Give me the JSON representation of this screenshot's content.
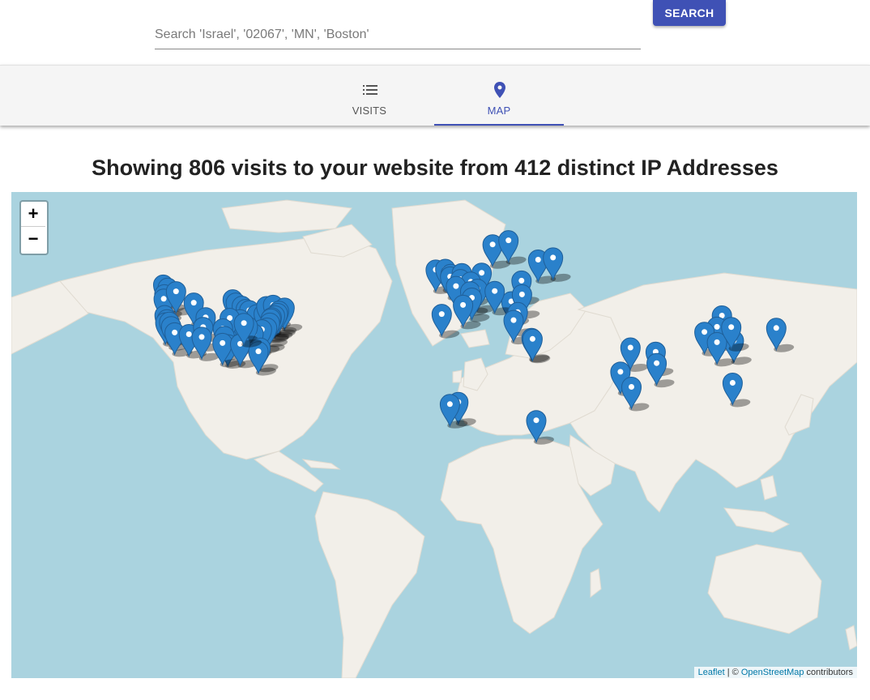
{
  "search": {
    "placeholder": "Search 'Israel', '02067', 'MN', 'Boston'",
    "value": "",
    "button_label": "SEARCH"
  },
  "tabs": [
    {
      "label": "VISITS",
      "icon": "list-icon",
      "active": false
    },
    {
      "label": "MAP",
      "icon": "location-pin-icon",
      "active": true
    }
  ],
  "heading": "Showing 806 visits to your website from 412 distinct IP Addresses",
  "map": {
    "zoom_in_label": "+",
    "zoom_out_label": "−",
    "attribution": {
      "leaflet_link": "Leaflet",
      "separator": " | © ",
      "osm_link": "OpenStreetMap",
      "suffix": " contributors"
    },
    "colors": {
      "water": "#aad3df",
      "land": "#f2efe9",
      "marker": "#2a81cb",
      "accent": "#3f51b5"
    },
    "markers": [
      {
        "lat": 49.3,
        "lon": -123.1
      },
      {
        "lat": 48.4,
        "lon": -121.2
      },
      {
        "lat": 46.5,
        "lon": -122.6
      },
      {
        "lat": 45.2,
        "lon": -122.9
      },
      {
        "lat": 47.4,
        "lon": -117.6
      },
      {
        "lat": 44.0,
        "lon": -110.0
      },
      {
        "lat": 40.0,
        "lon": -122.5
      },
      {
        "lat": 38.6,
        "lon": -121.5
      },
      {
        "lat": 37.6,
        "lon": -122.2
      },
      {
        "lat": 37.8,
        "lon": -120.5
      },
      {
        "lat": 36.3,
        "lon": -119.7
      },
      {
        "lat": 34.1,
        "lon": -118.2
      },
      {
        "lat": 33.5,
        "lon": -112.1
      },
      {
        "lat": 39.3,
        "lon": -104.9
      },
      {
        "lat": 36.0,
        "lon": -106.0
      },
      {
        "lat": 32.5,
        "lon": -106.6
      },
      {
        "lat": 45.0,
        "lon": -93.3
      },
      {
        "lat": 44.0,
        "lon": -92.0
      },
      {
        "lat": 43.0,
        "lon": -89.4
      },
      {
        "lat": 42.0,
        "lon": -87.7
      },
      {
        "lat": 41.6,
        "lon": -86.2
      },
      {
        "lat": 40.3,
        "lon": -83.0
      },
      {
        "lat": 40.5,
        "lon": -80.0
      },
      {
        "lat": 42.9,
        "lon": -78.9
      },
      {
        "lat": 43.3,
        "lon": -76.0
      },
      {
        "lat": 42.4,
        "lon": -71.1
      },
      {
        "lat": 41.4,
        "lon": -73.5
      },
      {
        "lat": 40.7,
        "lon": -74.0
      },
      {
        "lat": 39.9,
        "lon": -75.2
      },
      {
        "lat": 39.3,
        "lon": -76.6
      },
      {
        "lat": 38.9,
        "lon": -77.0
      },
      {
        "lat": 37.5,
        "lon": -77.4
      },
      {
        "lat": 35.8,
        "lon": -78.6
      },
      {
        "lat": 35.2,
        "lon": -80.8
      },
      {
        "lat": 33.7,
        "lon": -84.4
      },
      {
        "lat": 36.2,
        "lon": -86.8
      },
      {
        "lat": 35.1,
        "lon": -90.0
      },
      {
        "lat": 38.6,
        "lon": -90.2
      },
      {
        "lat": 39.1,
        "lon": -94.6
      },
      {
        "lat": 35.5,
        "lon": -97.5
      },
      {
        "lat": 32.8,
        "lon": -96.8
      },
      {
        "lat": 29.8,
        "lon": -95.4
      },
      {
        "lat": 30.3,
        "lon": -97.7
      },
      {
        "lat": 30.0,
        "lon": -90.1
      },
      {
        "lat": 28.5,
        "lon": -81.4
      },
      {
        "lat": 27.2,
        "lon": -82.3
      },
      {
        "lat": 37.4,
        "lon": -88.5
      },
      {
        "lat": 53.3,
        "lon": -6.3
      },
      {
        "lat": 53.5,
        "lon": -2.2
      },
      {
        "lat": 52.2,
        "lon": 0.1
      },
      {
        "lat": 51.5,
        "lon": -0.1
      },
      {
        "lat": 52.4,
        "lon": 4.9
      },
      {
        "lat": 52.5,
        "lon": 13.4
      },
      {
        "lat": 50.8,
        "lon": 4.3
      },
      {
        "lat": 50.1,
        "lon": 8.7
      },
      {
        "lat": 48.9,
        "lon": 2.4
      },
      {
        "lat": 48.1,
        "lon": 11.6
      },
      {
        "lat": 47.4,
        "lon": 8.5
      },
      {
        "lat": 45.5,
        "lon": 9.2
      },
      {
        "lat": 43.3,
        "lon": 5.4
      },
      {
        "lat": 40.4,
        "lon": -3.7
      },
      {
        "lat": 44.4,
        "lon": 26.1
      },
      {
        "lat": 47.5,
        "lon": 19.0
      },
      {
        "lat": 59.3,
        "lon": 18.1
      },
      {
        "lat": 60.2,
        "lon": 24.9
      },
      {
        "lat": 55.8,
        "lon": 37.6
      },
      {
        "lat": 56.3,
        "lon": 44.0
      },
      {
        "lat": 50.4,
        "lon": 30.5
      },
      {
        "lat": 46.5,
        "lon": 30.7
      },
      {
        "lat": 41.0,
        "lon": 28.9
      },
      {
        "lat": 38.4,
        "lon": 27.1
      },
      {
        "lat": 32.1,
        "lon": 34.8
      },
      {
        "lat": 31.8,
        "lon": 35.2
      },
      {
        "lat": 6.5,
        "lon": 3.4
      },
      {
        "lat": 5.6,
        "lon": -0.2
      },
      {
        "lat": -1.3,
        "lon": 36.8
      },
      {
        "lat": 28.6,
        "lon": 77.2
      },
      {
        "lat": 27.0,
        "lon": 88.0
      },
      {
        "lat": 22.6,
        "lon": 88.4
      },
      {
        "lat": 19.1,
        "lon": 72.9
      },
      {
        "lat": 12.9,
        "lon": 77.6
      },
      {
        "lat": 39.9,
        "lon": 116.4
      },
      {
        "lat": 36.1,
        "lon": 114.3
      },
      {
        "lat": 34.3,
        "lon": 108.9
      },
      {
        "lat": 31.2,
        "lon": 121.5
      },
      {
        "lat": 30.6,
        "lon": 114.3
      },
      {
        "lat": 36.0,
        "lon": 120.4
      },
      {
        "lat": 35.7,
        "lon": 139.7
      },
      {
        "lat": 14.6,
        "lon": 121.0
      }
    ]
  }
}
